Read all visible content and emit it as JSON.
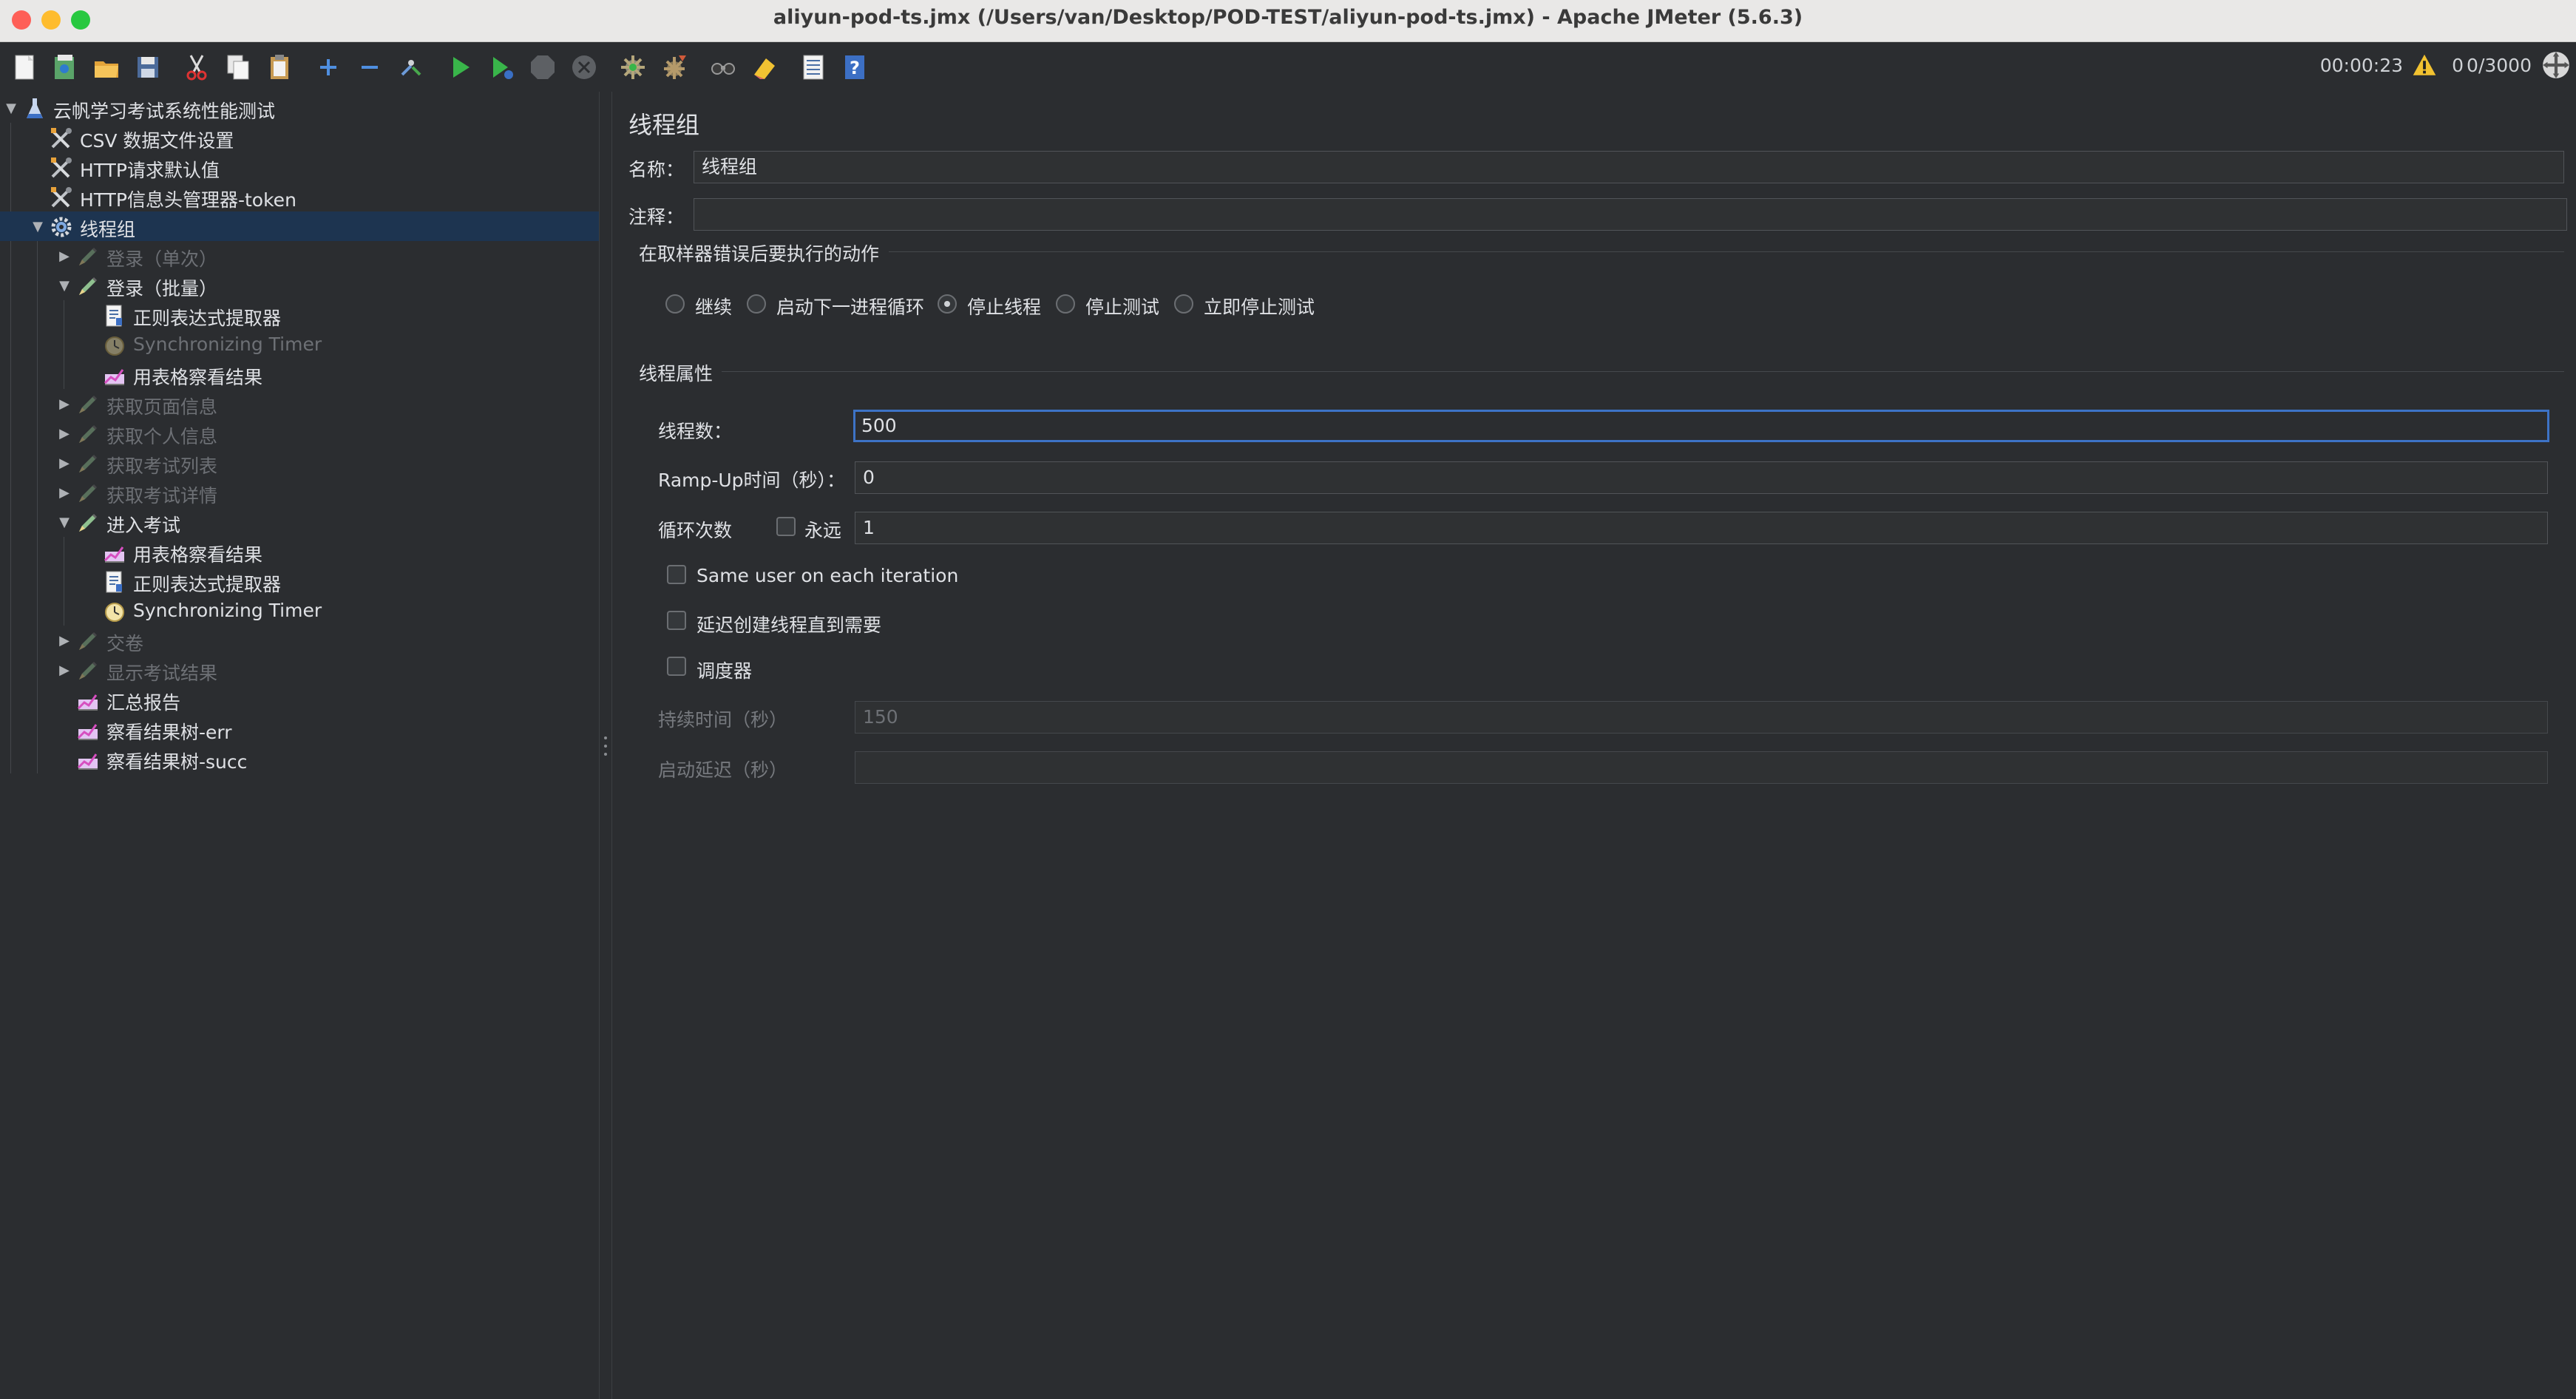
{
  "window": {
    "title": "aliyun-pod-ts.jmx (/Users/van/Desktop/POD-TEST/aliyun-pod-ts.jmx) - Apache JMeter (5.6.3)"
  },
  "toolbar": {
    "buttons": [
      "new-icon",
      "templates-icon",
      "open-icon",
      "save-icon",
      "cut-icon",
      "copy-icon",
      "paste-icon",
      "expand-icon",
      "collapse-icon",
      "toggle-icon",
      "start-icon",
      "start-no-pauses-icon",
      "stop-icon",
      "shutdown-icon",
      "clear-icon",
      "clear-all-icon",
      "search-icon",
      "reset-search-icon",
      "function-helper-icon",
      "help-icon"
    ],
    "elapsed": "00:00:23",
    "error_count": "0",
    "threads": "0/3000"
  },
  "tree": {
    "nodes": [
      {
        "label": "云帆学习考试系统性能测试",
        "icon": "test-plan-icon",
        "level": 0,
        "expanded": true,
        "disabled": false
      },
      {
        "label": "CSV 数据文件设置",
        "icon": "config-tools-icon",
        "level": 1,
        "disabled": false
      },
      {
        "label": "HTTP请求默认值",
        "icon": "config-tools-icon",
        "level": 1,
        "disabled": false
      },
      {
        "label": "HTTP信息头管理器-token",
        "icon": "config-tools-icon",
        "level": 1,
        "disabled": false
      },
      {
        "label": "线程组",
        "icon": "thread-group-gear-icon",
        "level": 1,
        "expanded": true,
        "selected": true,
        "disabled": false
      },
      {
        "label": "登录（单次）",
        "icon": "sampler-pen-icon",
        "level": 2,
        "collapsed": true,
        "disabled": true
      },
      {
        "label": "登录（批量）",
        "icon": "sampler-pen-icon",
        "level": 2,
        "expanded": true,
        "disabled": false
      },
      {
        "label": "正则表达式提取器",
        "icon": "extractor-doc-icon",
        "level": 3,
        "disabled": false
      },
      {
        "label": "Synchronizing Timer",
        "icon": "timer-icon",
        "level": 3,
        "disabled": true
      },
      {
        "label": "用表格察看结果",
        "icon": "listener-chart-icon",
        "level": 3,
        "disabled": false
      },
      {
        "label": "获取页面信息",
        "icon": "sampler-pen-icon",
        "level": 2,
        "collapsed": true,
        "disabled": true
      },
      {
        "label": "获取个人信息",
        "icon": "sampler-pen-icon",
        "level": 2,
        "collapsed": true,
        "disabled": true
      },
      {
        "label": "获取考试列表",
        "icon": "sampler-pen-icon",
        "level": 2,
        "collapsed": true,
        "disabled": true
      },
      {
        "label": "获取考试详情",
        "icon": "sampler-pen-icon",
        "level": 2,
        "collapsed": true,
        "disabled": true
      },
      {
        "label": "进入考试",
        "icon": "sampler-pen-icon",
        "level": 2,
        "expanded": true,
        "disabled": false
      },
      {
        "label": "用表格察看结果",
        "icon": "listener-chart-icon",
        "level": 3,
        "disabled": false
      },
      {
        "label": "正则表达式提取器",
        "icon": "extractor-doc-icon",
        "level": 3,
        "disabled": false
      },
      {
        "label": "Synchronizing Timer",
        "icon": "timer-icon",
        "level": 3,
        "disabled": false
      },
      {
        "label": "交卷",
        "icon": "sampler-pen-icon",
        "level": 2,
        "collapsed": true,
        "disabled": true
      },
      {
        "label": "显示考试结果",
        "icon": "sampler-pen-icon",
        "level": 2,
        "collapsed": true,
        "disabled": true
      },
      {
        "label": "汇总报告",
        "icon": "listener-chart-icon",
        "level": 2,
        "disabled": false
      },
      {
        "label": "察看结果树-err",
        "icon": "listener-chart-icon",
        "level": 2,
        "disabled": false
      },
      {
        "label": "察看结果树-succ",
        "icon": "listener-chart-icon",
        "level": 2,
        "disabled": false
      }
    ]
  },
  "panel": {
    "title": "线程组",
    "name_label": "名称：",
    "name_value": "线程组",
    "comment_label": "注释：",
    "comment_value": "",
    "error_section": "在取样器错误后要执行的动作",
    "error_actions": [
      {
        "label": "继续",
        "checked": false
      },
      {
        "label": "启动下一进程循环",
        "checked": false
      },
      {
        "label": "停止线程",
        "checked": true
      },
      {
        "label": "停止测试",
        "checked": false
      },
      {
        "label": "立即停止测试",
        "checked": false
      }
    ],
    "thread_section": "线程属性",
    "threads_label": "线程数：",
    "threads_value": "500",
    "rampup_label": "Ramp-Up时间（秒）：",
    "rampup_value": "0",
    "loop_label": "循环次数",
    "forever_label": "永远",
    "loop_value": "1",
    "same_user_label": "Same user on each iteration",
    "delay_label": "延迟创建线程直到需要",
    "scheduler_label": "调度器",
    "duration_label": "持续时间（秒）",
    "duration_value": "150",
    "startup_delay_label": "启动延迟（秒）",
    "startup_delay_value": ""
  }
}
